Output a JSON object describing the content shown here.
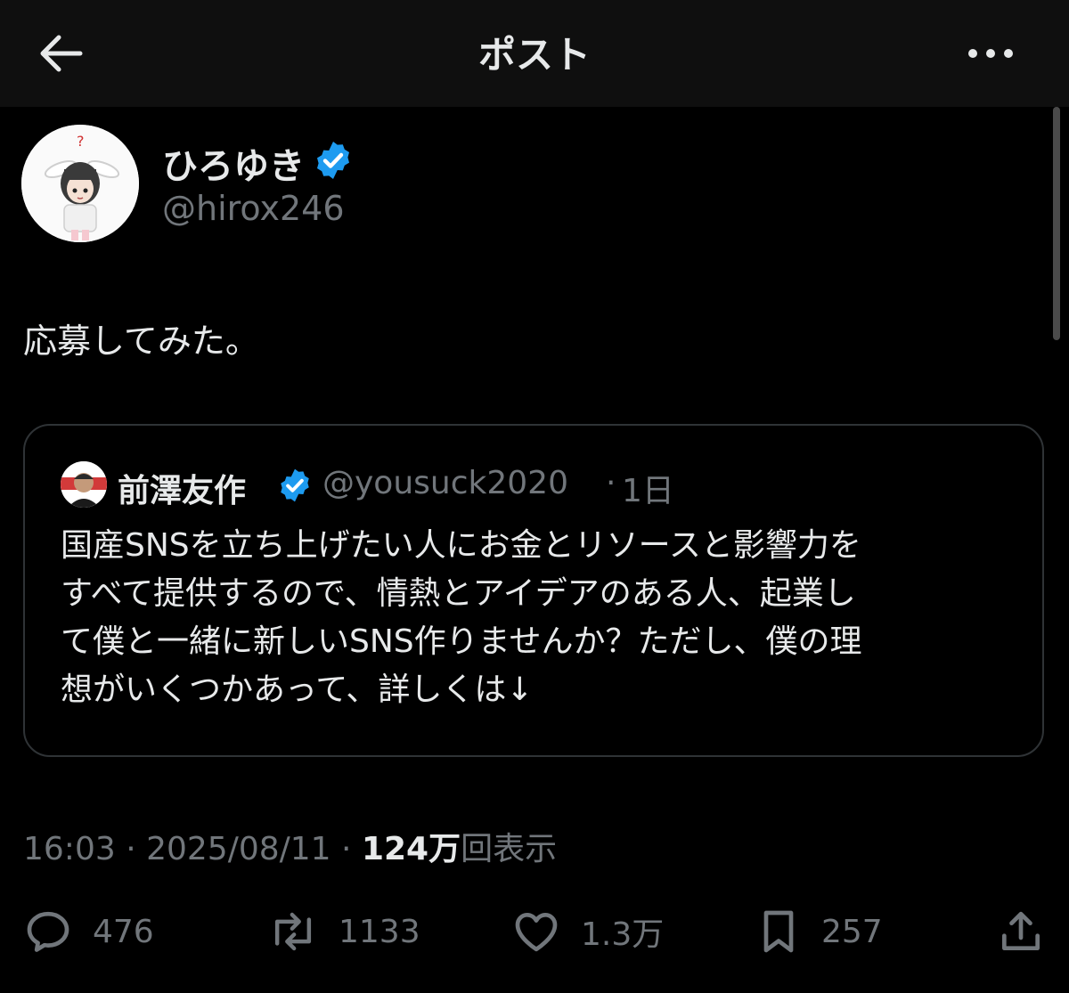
{
  "header": {
    "title": "ポスト",
    "back_icon": "arrow-left-icon",
    "more_icon": "more-horizontal-icon"
  },
  "post": {
    "author": {
      "display_name": "ひろゆき",
      "handle": "@hirox246",
      "verified": true,
      "avatar_icon": "avatar-illustration"
    },
    "text": "応募してみた。",
    "quoted": {
      "author": {
        "display_name": "前澤友作",
        "handle": "@yousuck2020",
        "verified": true
      },
      "separator": "·",
      "time": "1日",
      "lines": [
        "国産SNSを立ち上げたい人にお金とリソースと影響力を",
        "すべて提供するので、情熱とアイデアのある人、起業し",
        "て僕と一緒に新しいSNS作りませんか？ただし、僕の理",
        "想がいくつかあって、詳しくは↓"
      ]
    },
    "meta": {
      "time": "16:03",
      "sep1": " · ",
      "date": "2025/08/11",
      "sep2": " · ",
      "views_num": "124万",
      "views_label": "回表示"
    },
    "actions": {
      "reply": {
        "count": "476",
        "icon": "reply-icon"
      },
      "repost": {
        "count": "1133",
        "icon": "repost-icon"
      },
      "like": {
        "count": "1.3万",
        "icon": "heart-icon"
      },
      "bookmark": {
        "count": "257",
        "icon": "bookmark-icon"
      },
      "share": {
        "icon": "share-icon"
      }
    }
  },
  "colors": {
    "background": "#000000",
    "header_bg": "#0f0f0f",
    "text_primary": "#e7e9ea",
    "text_secondary": "#71767b",
    "verified_blue": "#1d9bf0",
    "border": "#2f3336"
  }
}
